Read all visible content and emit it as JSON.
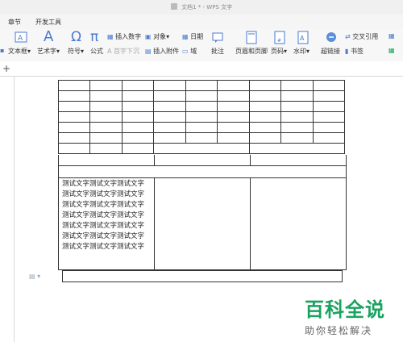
{
  "window": {
    "title": "文档1 * - WPS 文字"
  },
  "tabs": [
    "章节",
    "开发工具"
  ],
  "ribbon": {
    "textbox": "文本框",
    "wordart": "艺术字",
    "symbol": "符号",
    "formula": "公式",
    "insert_number": "插入数字",
    "object": "对象",
    "first_drop": "首字下沉",
    "insert_attachment": "插入附件",
    "date": "日期",
    "field": "域",
    "comment": "批注",
    "header_footer": "页眉和页脚",
    "page_number": "页码",
    "watermark": "水印",
    "hyperlink": "超链接",
    "cross_ref": "交叉引用",
    "bookmark": "书签"
  },
  "document": {
    "text_lines": [
      "测试文字测试文字测试文字",
      "测试文字测试文字测试文字",
      "测试文字测试文字测试文字",
      "测试文字测试文字测试文字",
      "测试文字测试文字测试文字",
      "测试文字测试文字测试文字",
      "测试文字测试文字测试文字"
    ]
  },
  "watermark": {
    "brand": "百科全说",
    "slogan": "助你轻松解决"
  }
}
